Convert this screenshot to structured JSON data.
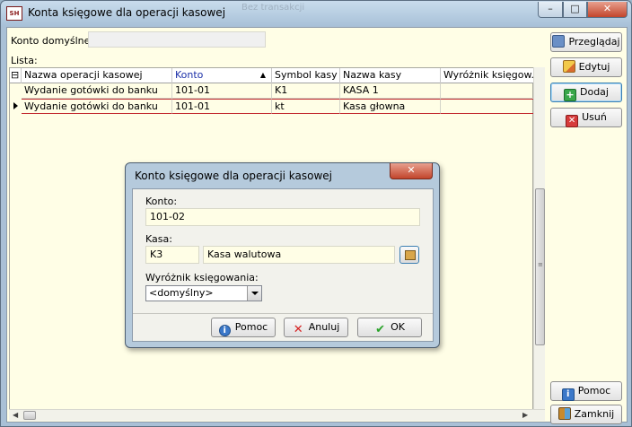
{
  "window": {
    "title": "Konta księgowe dla operacji kasowej",
    "app_icon_text": "SH",
    "ghost_bg": [
      "Bez transakcji",
      "Bez transakcji"
    ]
  },
  "header": {
    "default_account_label": "Konto domyślne:",
    "default_account_value": "",
    "list_label": "Lista:"
  },
  "grid": {
    "columns": [
      "Nazwa operacji kasowej",
      "Konto",
      "Symbol kasy",
      "Nazwa kasy",
      "Wyróżnik księgow..."
    ],
    "sorted_column": "Konto",
    "rows": [
      [
        "Wydanie gotówki do banku",
        "101-01",
        "K1",
        "KASA 1",
        ""
      ],
      [
        "Wydanie gotówki do banku",
        "101-01",
        "kt",
        "Kasa głowna",
        ""
      ]
    ],
    "current_row": 1
  },
  "buttons": {
    "browse": "Przeglądaj",
    "edit": "Edytuj",
    "add": "Dodaj",
    "delete": "Usuń",
    "help": "Pomoc",
    "close": "Zamknij"
  },
  "dialog": {
    "title": "Konto księgowe dla operacji kasowej",
    "account_label": "Konto:",
    "account_value": "101-02",
    "cash_label": "Kasa:",
    "cash_code": "K3",
    "cash_name": "Kasa walutowa",
    "marker_label": "Wyróżnik księgowania:",
    "marker_value": "<domyślny>",
    "help": "Pomoc",
    "cancel": "Anuluj",
    "ok": "OK"
  },
  "colors": {
    "client_bg": "#fffee6",
    "selected_row_border": "#c1272d",
    "sorted_header": "#1b2fa8"
  }
}
